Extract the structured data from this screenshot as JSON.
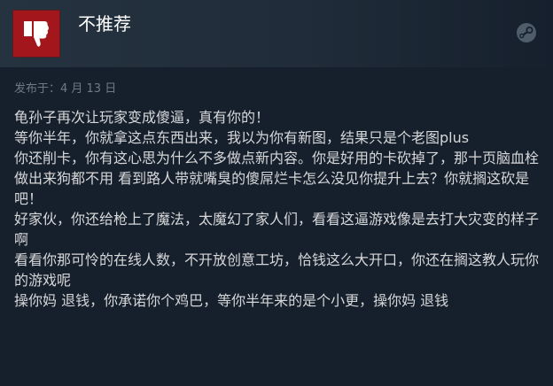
{
  "review": {
    "verdict": "不推荐",
    "posted": "发布于：4 月 13 日",
    "lines": [
      "龟孙子再次让玩家变成傻逼，真有你的！",
      "等你半年，你就拿这点东西出来，我以为你有新图，结果只是个老图plus",
      "你还削卡，你有这心思为什么不多做点新内容。你是好用的卡砍掉了，那十页脑血栓做出来狗都不用 看到路人带就嘴臭的傻屌烂卡怎么没见你提升上去？你就搁这砍是吧！",
      "好家伙，你还给枪上了魔法，太魔幻了家人们，看看这逼游戏像是去打大灾变的样子啊",
      "看看你那可怜的在线人数，不开放创意工坊，恰钱这么大开口，你还在搁这教人玩你的游戏呢",
      "操你妈 退钱，你承诺你个鸡巴，等你半年来的是个小更，操你妈 退钱"
    ]
  },
  "icons": {
    "thumb": "thumbs-down-icon",
    "steam": "steam-logo-icon"
  },
  "colors": {
    "background": "#16202d",
    "header_gradient_start": "#25323f",
    "thumb_box": "#a3161c",
    "text": "#d6d7d8",
    "muted": "#6f7a84"
  }
}
